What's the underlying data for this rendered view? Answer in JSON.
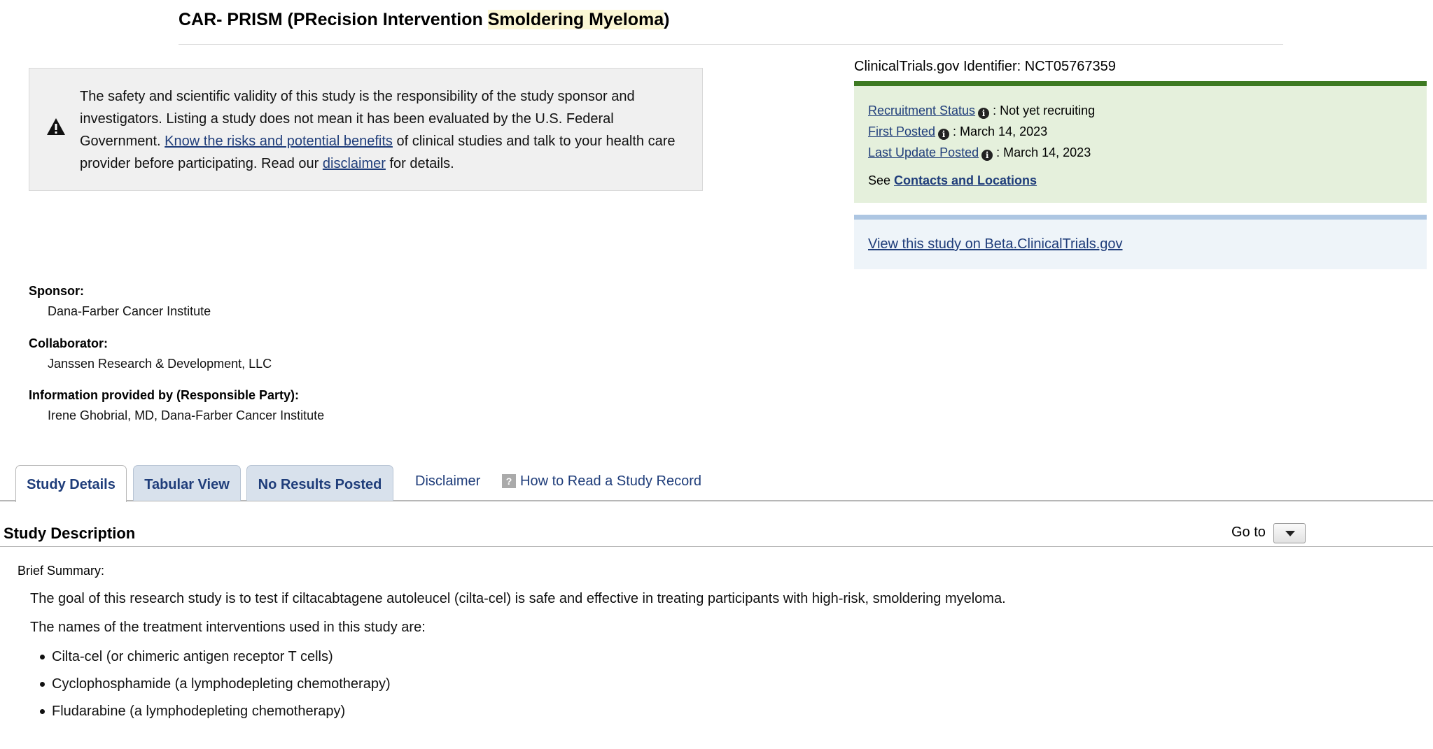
{
  "study": {
    "title_part1": "CAR- PRISM (PRecision Intervention ",
    "title_highlight": "Smoldering Myeloma",
    "title_part2": ")"
  },
  "warning": {
    "text_before_link1": "The safety and scientific validity of this study is the responsibility of the study sponsor and investigators. Listing a study does not mean it has been evaluated by the U.S. Federal Government. ",
    "link1": "Know the risks and potential benefits",
    "text_between": " of clinical studies and talk to your health care provider before participating. Read our ",
    "link2": "disclaimer",
    "text_after": " for details."
  },
  "identifier": {
    "label": "ClinicalTrials.gov Identifier: ",
    "value": "NCT05767359"
  },
  "status": {
    "recruitment_label": "Recruitment Status",
    "recruitment_value": ": Not yet recruiting",
    "first_posted_label": "First Posted",
    "first_posted_value": ": March 14, 2023",
    "last_update_label": "Last Update Posted",
    "last_update_value": ": March 14, 2023",
    "see_prefix": "See ",
    "contacts_link": "Contacts and Locations"
  },
  "beta": {
    "link": "View this study on Beta.ClinicalTrials.gov"
  },
  "sponsor": {
    "label": "Sponsor:",
    "value": "Dana-Farber Cancer Institute"
  },
  "collaborator": {
    "label": "Collaborator:",
    "value": "Janssen Research & Development, LLC"
  },
  "responsible": {
    "label": "Information provided by (Responsible Party):",
    "value": "Irene Ghobrial, MD, Dana-Farber Cancer Institute"
  },
  "tabs": [
    {
      "label": "Study Details"
    },
    {
      "label": "Tabular View"
    },
    {
      "label": "No Results Posted"
    }
  ],
  "tab_links": {
    "disclaimer": "Disclaimer",
    "how_to_read": "How to Read a Study Record"
  },
  "description": {
    "section_title": "Study Description",
    "goto_label": "Go to",
    "brief_label": "Brief Summary:",
    "summary": "The goal of this research study is to test if ciltacabtagene autoleucel (cilta-cel) is safe and effective in treating participants with high-risk, smoldering myeloma.",
    "interventions_intro": "The names of the treatment interventions used in this study are:",
    "interventions": [
      "Cilta-cel (or chimeric antigen receptor T cells)",
      "Cyclophosphamide (a lymphodepleting chemotherapy)",
      "Fludarabine (a lymphodepleting chemotherapy)"
    ]
  },
  "colors": {
    "link": "#1f3d7a",
    "status_box_bg": "#e5f0dc",
    "status_box_border": "#3d7a22",
    "beta_box_bg": "#eef4f9",
    "beta_box_border": "#adc6e2",
    "tab_bg": "#d8e1ec",
    "title_highlight": "#fbf7d4"
  }
}
